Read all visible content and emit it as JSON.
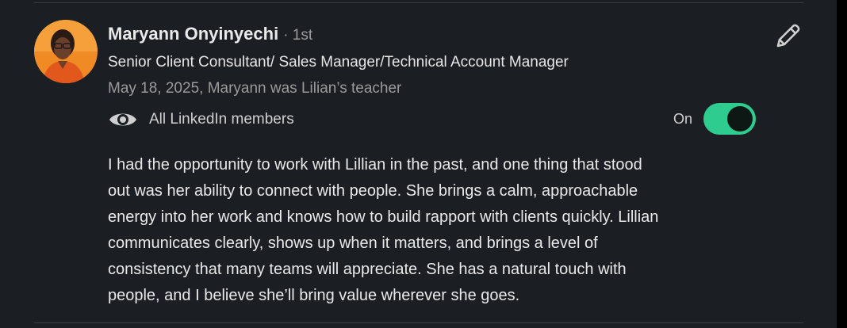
{
  "recommendation": {
    "author_name": "Maryann Onyinyechi",
    "connection_degree": "· 1st",
    "headline": "Senior Client Consultant/ Sales Manager/Technical Account Manager",
    "meta": "May 18, 2025, Maryann was Lilian’s teacher",
    "visibility": {
      "icon": "eye-icon",
      "label": "All LinkedIn members"
    },
    "toggle": {
      "label": "On",
      "state": true,
      "color": "#2ecc8e"
    },
    "edit_icon": "pencil-icon",
    "body": [
      "I had the opportunity to work with Lillian in the past, and one thing that stood",
      "out was her ability to connect with people. She brings a calm, approachable",
      "energy into her work and knows how to build rapport with clients quickly. Lillian",
      "communicates clearly, shows up when it matters, and brings a level of",
      "consistency that many teams will appreciate. She has a natural touch with",
      "people, and I believe she’ll bring value wherever she goes."
    ]
  },
  "colors": {
    "background": "#1b1f23",
    "accent": "#2ecc8e",
    "muted_text": "#9a9a9a"
  }
}
